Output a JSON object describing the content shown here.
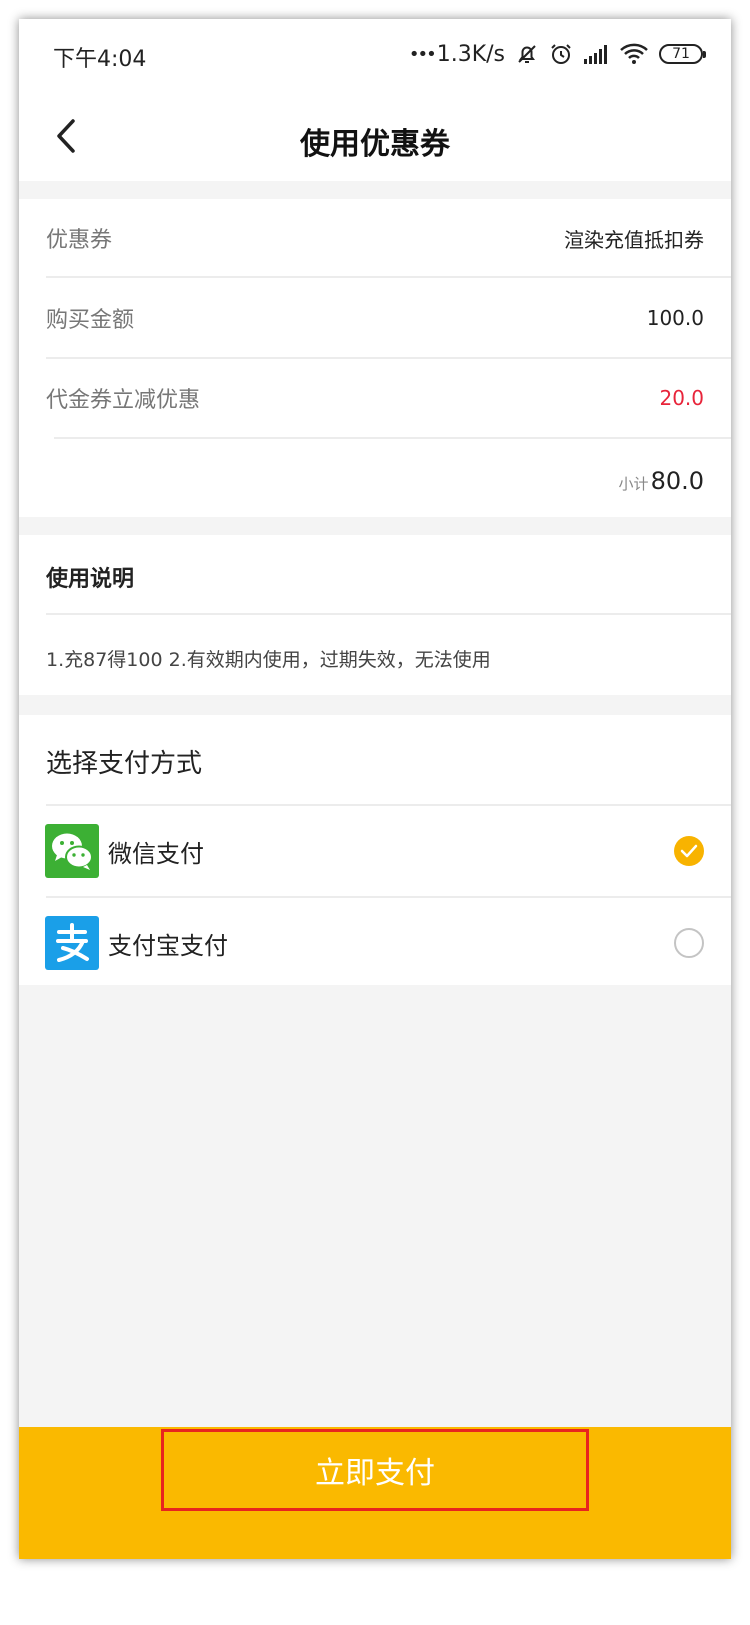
{
  "status_bar": {
    "time": "下午4:04",
    "dots": "•••",
    "speed": "1.3K/s",
    "battery": "71"
  },
  "nav": {
    "title": "使用优惠券"
  },
  "coupon": {
    "rows": [
      {
        "label": "优惠券",
        "value": "渲染充值抵扣券"
      },
      {
        "label": "购买金额",
        "value": "100.0"
      },
      {
        "label": "代金券立减优惠",
        "value": "20.0"
      }
    ],
    "subtotal_label": "小计",
    "subtotal_value": "80.0"
  },
  "instructions": {
    "heading": "使用说明",
    "text": "1.充87得100  2.有效期内使用，过期失效，无法使用"
  },
  "payment": {
    "heading": "选择支付方式",
    "methods": [
      {
        "label": "微信支付",
        "icon": "wechat-pay-icon",
        "selected": true
      },
      {
        "label": "支付宝支付",
        "icon": "alipay-icon",
        "selected": false
      }
    ]
  },
  "footer": {
    "pay_button": "立即支付"
  },
  "colors": {
    "accent": "#fab900",
    "discount": "#e8243a",
    "wechat": "#3cb034",
    "alipay": "#1a9fe8"
  }
}
